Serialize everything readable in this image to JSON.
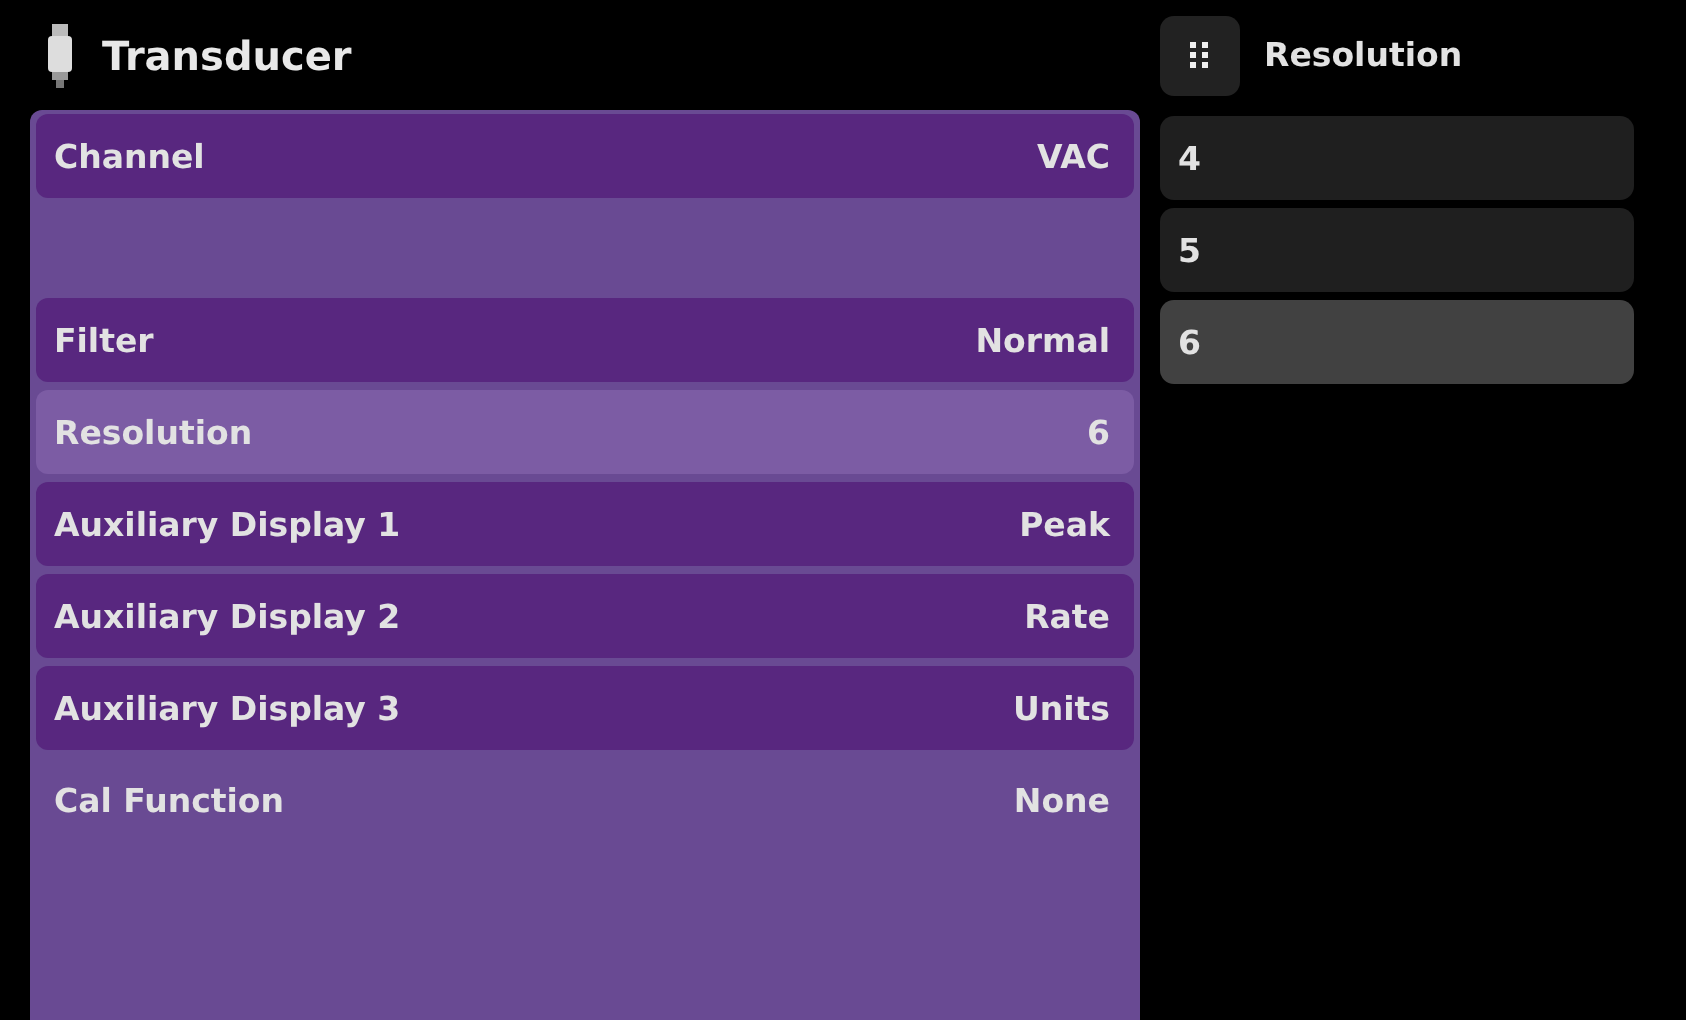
{
  "header": {
    "title": "Transducer"
  },
  "rows": [
    {
      "kind": "button",
      "label": "Channel",
      "value": "VAC",
      "selected": false
    },
    {
      "kind": "blank"
    },
    {
      "kind": "button",
      "label": "Filter",
      "value": "Normal",
      "selected": false
    },
    {
      "kind": "button",
      "label": "Resolution",
      "value": "6",
      "selected": true
    },
    {
      "kind": "button",
      "label": "Auxiliary Display 1",
      "value": "Peak",
      "selected": false
    },
    {
      "kind": "button",
      "label": "Auxiliary Display 2",
      "value": "Rate",
      "selected": false
    },
    {
      "kind": "button",
      "label": "Auxiliary Display 3",
      "value": "Units",
      "selected": false
    },
    {
      "kind": "plain",
      "label": "Cal Function",
      "value": "None"
    }
  ],
  "picker": {
    "title": "Resolution",
    "options": [
      {
        "label": "4",
        "selected": false
      },
      {
        "label": "5",
        "selected": false
      },
      {
        "label": "6",
        "selected": true
      }
    ]
  }
}
